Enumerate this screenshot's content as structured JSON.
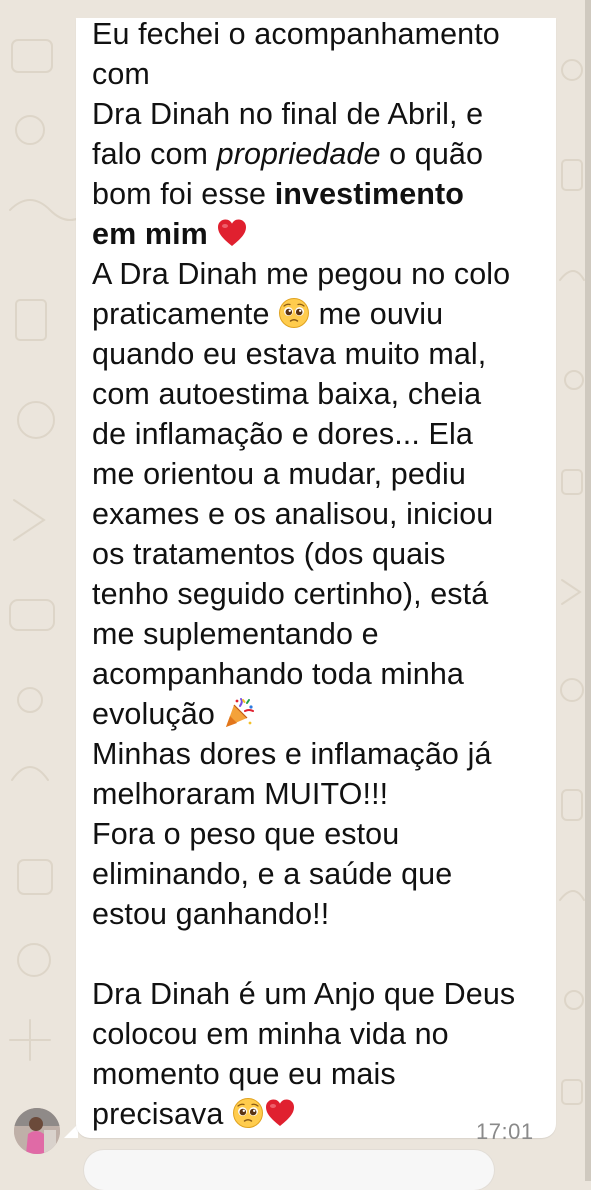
{
  "chat": {
    "message": {
      "l1": "Eu fechei o acompanhamento",
      "l2": "com",
      "l3": "Dra Dinah no final de Abril, e",
      "l4a": "falo com ",
      "l4b": "propriedade",
      "l4c": " o quão",
      "l5a": "bom foi esse ",
      "l5b": "investimento",
      "l6": "em mim",
      "l7": "A Dra Dinah me pegou no colo",
      "l8a": "praticamente ",
      "l8b": " me ouviu",
      "l9": "quando eu estava muito mal,",
      "l10": "com autoestima baixa, cheia",
      "l11": "de inflamação e dores... Ela",
      "l12": "me orientou a mudar, pediu",
      "l13": "exames e os analisou, iniciou",
      "l14": "os tratamentos (dos quais",
      "l15": "tenho seguido certinho), está",
      "l16": "me suplementando e",
      "l17": "acompanhando toda minha",
      "l18": "evolução",
      "l19": "Minhas dores e inflamação já",
      "l20": "melhoraram MUITO!!!",
      "l21": "Fora o peso que estou",
      "l22": "eliminando, e a saúde que",
      "l23": "estou ganhando!!",
      "l24": "Dra Dinah é um Anjo que Deus",
      "l25": "colocou em minha vida no",
      "l26": "momento que eu mais",
      "l27": "precisava"
    },
    "timestamp": "17:01"
  },
  "emojis": {
    "heart": "red-heart-emoji",
    "pleading": "pleading-face-emoji",
    "party": "party-popper-emoji"
  },
  "colors": {
    "wallpaper": "#ebe5dc",
    "bubble": "#ffffff",
    "text": "#111111",
    "timestamp": "#8a8a8a",
    "heart": "#e0202f"
  }
}
